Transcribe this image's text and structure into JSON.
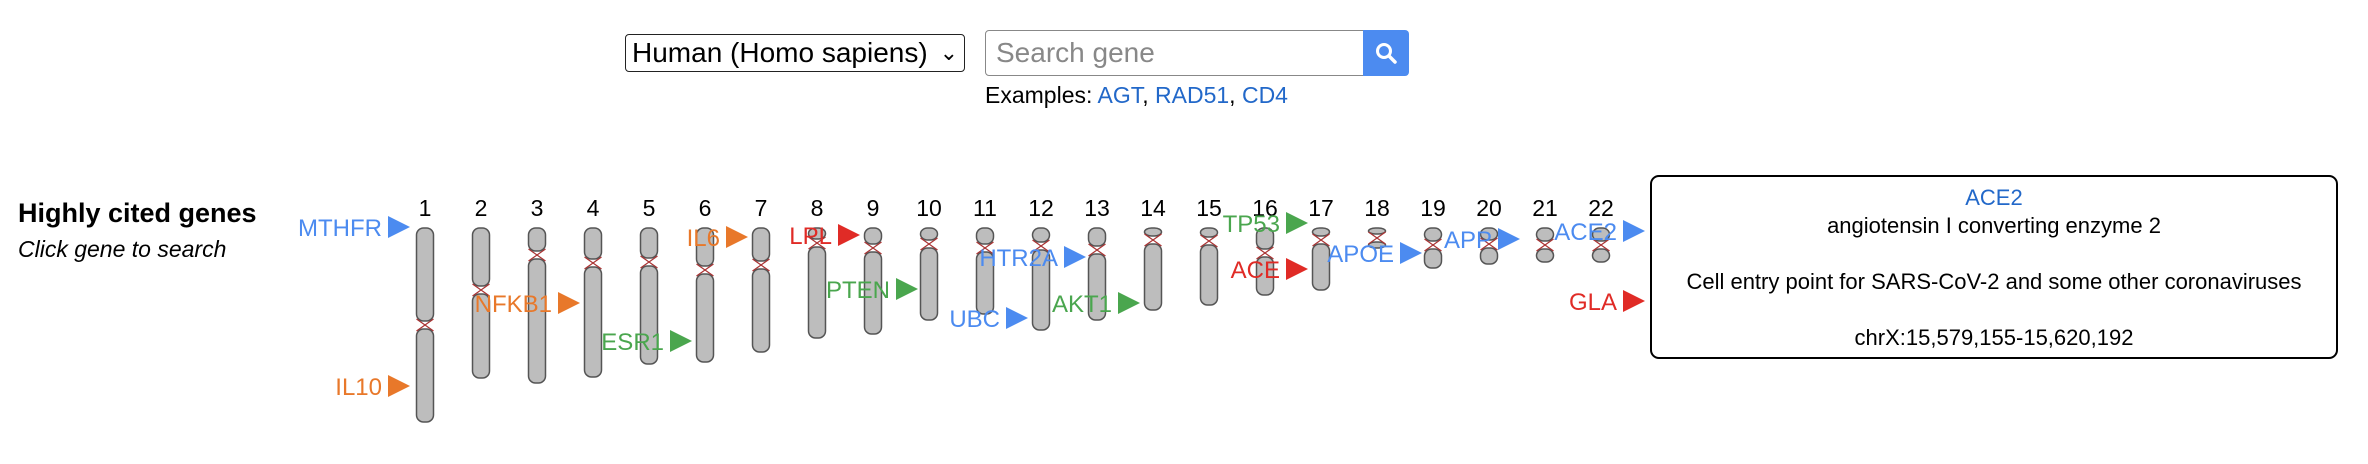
{
  "search": {
    "species": "Human (Homo sapiens)",
    "placeholder": "Search gene",
    "button_icon": "search-icon",
    "examples_label": "Examples: ",
    "examples": [
      "AGT",
      "RAD51",
      "CD4"
    ]
  },
  "sidebar": {
    "title": "Highly cited genes",
    "subtitle": "Click gene to search"
  },
  "chromosomes": [
    "1",
    "2",
    "3",
    "4",
    "5",
    "6",
    "7",
    "8",
    "9",
    "10",
    "11",
    "12",
    "13",
    "14",
    "15",
    "16",
    "17",
    "18",
    "19",
    "20",
    "21",
    "22"
  ],
  "genes": [
    {
      "name": "MTHFR",
      "color": "#4c8bf0"
    },
    {
      "name": "IL10",
      "color": "#e8782a"
    },
    {
      "name": "NFKB1",
      "color": "#e8782a"
    },
    {
      "name": "ESR1",
      "color": "#4aa64e"
    },
    {
      "name": "IL6",
      "color": "#e8782a"
    },
    {
      "name": "LPL",
      "color": "#e02b26"
    },
    {
      "name": "PTEN",
      "color": "#4aa64e"
    },
    {
      "name": "HTR2A",
      "color": "#4c8bf0"
    },
    {
      "name": "UBC",
      "color": "#4c8bf0"
    },
    {
      "name": "AKT1",
      "color": "#4aa64e"
    },
    {
      "name": "TP53",
      "color": "#4aa64e"
    },
    {
      "name": "ACE",
      "color": "#e02b26"
    },
    {
      "name": "APOE",
      "color": "#4c8bf0"
    },
    {
      "name": "APP",
      "color": "#4c8bf0"
    },
    {
      "name": "ACE2",
      "color": "#4c8bf0"
    },
    {
      "name": "GLA",
      "color": "#e02b26"
    }
  ],
  "tooltip": {
    "name": "ACE2",
    "full_name": "angiotensin I converting enzyme 2",
    "description": "Cell entry point for SARS-CoV-2 and some other coronaviruses",
    "location": "chrX:15,579,155-15,620,192"
  },
  "colors": {
    "blue": "#4c8bf0",
    "orange": "#e8782a",
    "green": "#4aa64e",
    "red": "#e02b26",
    "chromosome": "#bdbdbd",
    "link": "#2268c9"
  }
}
